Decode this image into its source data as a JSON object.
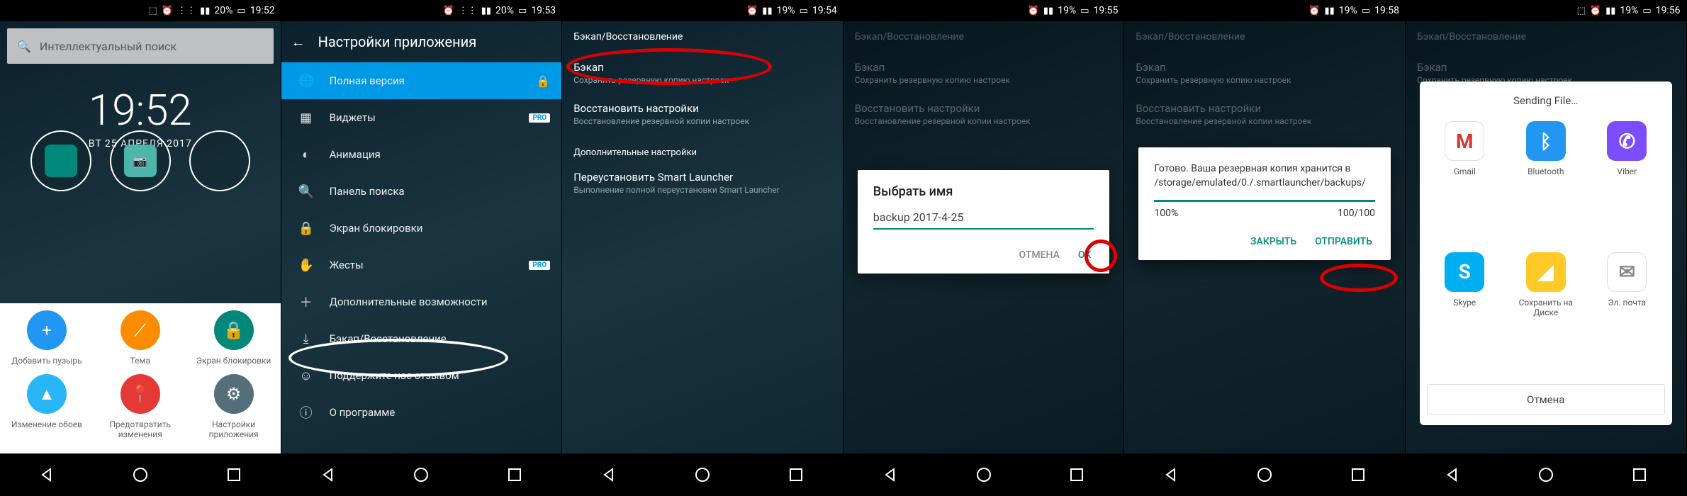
{
  "status": {
    "alarm_icon": "⏰",
    "wifi_icon": "📶",
    "signal_icon": "▮",
    "battery_icon": "▭"
  },
  "times": [
    "19:52",
    "19:53",
    "19:54",
    "19:55",
    "19:58",
    "19:56"
  ],
  "batteries": [
    "20%",
    "20%",
    "19%",
    "19%",
    "19%",
    "19%"
  ],
  "s1": {
    "search_placeholder": "Интеллектуальный поиск",
    "clock_time": "19:52",
    "clock_date": "ВТ 25 АПРЕЛЯ 2017",
    "panel": [
      {
        "label": "Добавить пузырь",
        "color": "#2196f3",
        "glyph": "+"
      },
      {
        "label": "Тема",
        "color": "#fb8c00",
        "glyph": "⟋"
      },
      {
        "label": "Экран блокировки",
        "color": "#00897b",
        "glyph": "🔒"
      },
      {
        "label": "Изменение обоев",
        "color": "#29b6f6",
        "glyph": "▲"
      },
      {
        "label": "Предотвратить изменения",
        "color": "#e53935",
        "glyph": "📍"
      },
      {
        "label": "Настройки приложения",
        "color": "#546e7a",
        "glyph": "⚙"
      }
    ]
  },
  "s2": {
    "header": "Настройки приложения",
    "rows": [
      {
        "icon": "🌐",
        "text": "Полная версия",
        "highlight": true,
        "lock": true
      },
      {
        "icon": "▦",
        "text": "Виджеты",
        "pro": true
      },
      {
        "icon": "◐",
        "text": "Анимация"
      },
      {
        "icon": "🔍",
        "text": "Панель поиска"
      },
      {
        "icon": "🔒",
        "text": "Экран блокировки"
      },
      {
        "icon": "✋",
        "text": "Жесты",
        "pro": true
      },
      {
        "icon": "＋",
        "text": "Дополнительные возможности"
      },
      {
        "icon": "⤓",
        "text": "Бэкап/Восстановление"
      },
      {
        "icon": "☺",
        "text": "Поддержите нас отзывом"
      },
      {
        "icon": "ⓘ",
        "text": "О программе"
      }
    ]
  },
  "s3": {
    "head": "Бэкап/Восстановление",
    "items": [
      {
        "t": "Бэкап",
        "st": "Сохранить резервную копию настроек"
      },
      {
        "t": "Восстановить настройки",
        "st": "Восстановление резервной копии настроек"
      }
    ],
    "section": "Дополнительные настройки",
    "reinstall": {
      "t": "Переустановить Smart Launcher",
      "st": "Выполнение полной переустановки Smart Launcher"
    }
  },
  "s4": {
    "dialog_title": "Выбрать имя",
    "input_value": "backup 2017-4-25",
    "cancel": "ОТМЕНА",
    "ok": "OK"
  },
  "s5": {
    "msg": "Готово. Ваша резервная копия хранится в /storage/emulated/0./.smartlauncher/backups/",
    "pct": "100%",
    "count": "100/100",
    "close": "ЗАКРЫТЬ",
    "send": "ОТПРАВИТЬ"
  },
  "s6": {
    "title": "Sending File…",
    "apps": [
      {
        "label": "Gmail",
        "color": "#ffffff",
        "glyph": "M",
        "fg": "#d33"
      },
      {
        "label": "Bluetooth",
        "color": "#2196f3",
        "glyph": "ᛒ"
      },
      {
        "label": "Viber",
        "color": "#7c4dff",
        "glyph": "✆"
      },
      {
        "label": "Skype",
        "color": "#00aff0",
        "glyph": "S"
      },
      {
        "label": "Сохранить на Диске",
        "color": "#ffca28",
        "glyph": "◢"
      },
      {
        "label": "Эл. почта",
        "color": "#ffffff",
        "glyph": "✉",
        "fg": "#888"
      }
    ],
    "cancel": "Отмена"
  }
}
